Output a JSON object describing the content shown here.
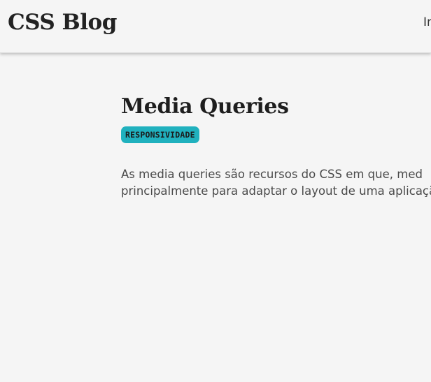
{
  "header": {
    "brand": "CSS Blog",
    "nav_partial": "In"
  },
  "post": {
    "title": "Media Queries",
    "tag": "RESPONSIVIDADE",
    "body_line1": "As media queries são recursos do CSS em que, med",
    "body_line2": "principalmente para adaptar o layout de uma aplicaçã"
  },
  "colors": {
    "background": "#f5f5f5",
    "tag_background": "#20b1be",
    "text": "#222222"
  }
}
